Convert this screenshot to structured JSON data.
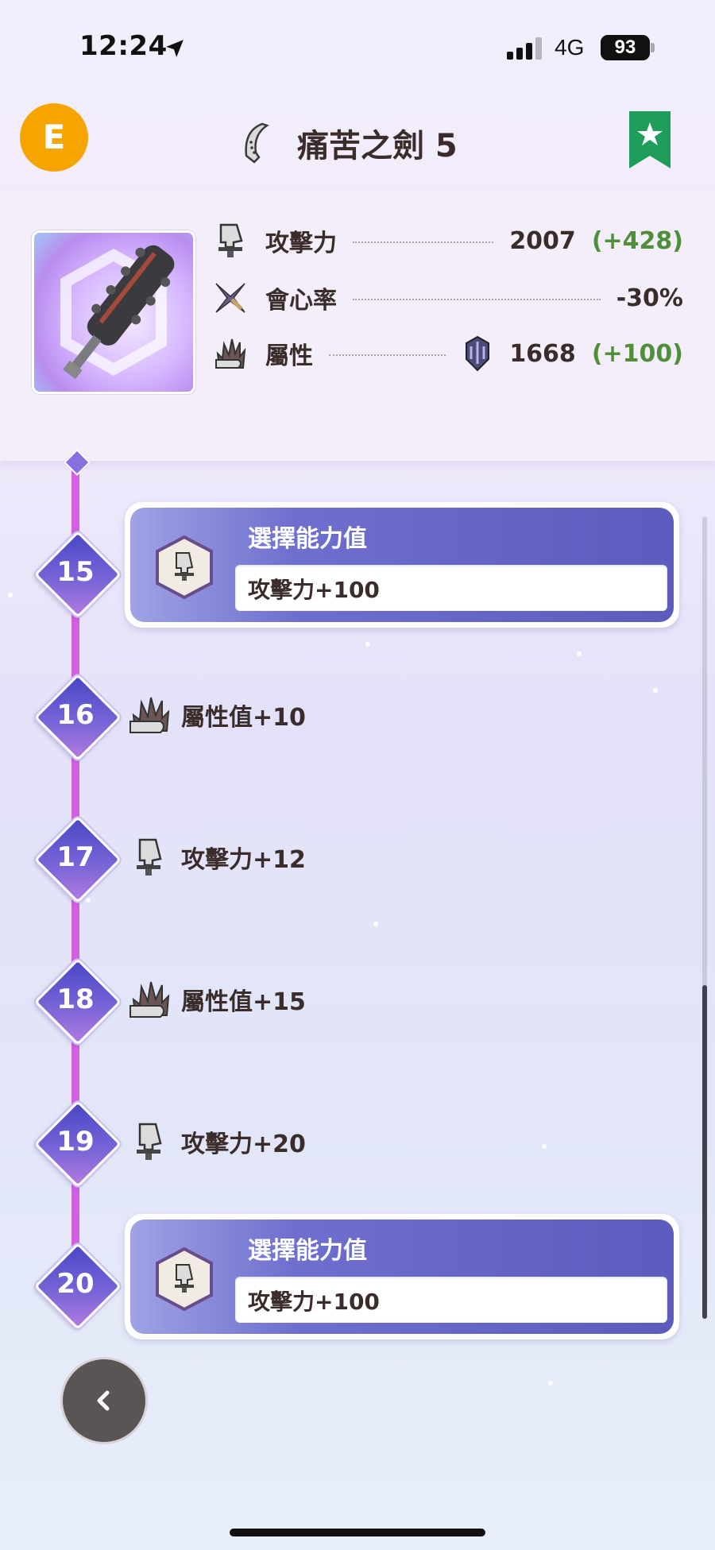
{
  "status_bar": {
    "time": "12:24",
    "network": "4G",
    "battery": "93"
  },
  "header": {
    "rank_badge": "E",
    "title": "痛苦之劍 5",
    "bookmark_icon": "star-bookmark-icon",
    "bookmark_color": "#1f9e5a"
  },
  "stats": {
    "attack": {
      "label": "攻擊力",
      "value": "2007",
      "bonus": "(+428)"
    },
    "affinity": {
      "label": "會心率",
      "value": "-30%"
    },
    "element": {
      "label": "屬性",
      "value": "1668",
      "bonus": "(+100)",
      "element_icon": "dragon-element-icon"
    }
  },
  "levels": [
    {
      "num": "15",
      "type": "choice",
      "title": "選擇能力值",
      "value": "攻擊力+100"
    },
    {
      "num": "16",
      "type": "text",
      "icon": "element-claw-icon",
      "label": "屬性值+10"
    },
    {
      "num": "17",
      "type": "text",
      "icon": "attack-blade-icon",
      "label": "攻擊力+12"
    },
    {
      "num": "18",
      "type": "text",
      "icon": "element-claw-icon",
      "label": "屬性值+15"
    },
    {
      "num": "19",
      "type": "text",
      "icon": "attack-blade-icon",
      "label": "攻擊力+20"
    },
    {
      "num": "20",
      "type": "choice",
      "title": "選擇能力值",
      "value": "攻擊力+100"
    }
  ],
  "colors": {
    "track": "#d35fe1",
    "bonus_green": "#4f8f3a",
    "rank_orange": "#f6a400"
  }
}
